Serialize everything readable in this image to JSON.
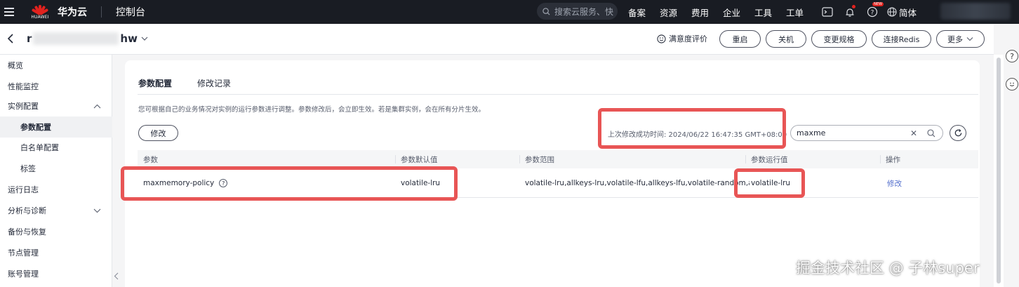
{
  "topbar": {
    "brand_word": "HUAWEI",
    "brand": "华为云",
    "console": "控制台",
    "search_placeholder": "搜索云服务、快",
    "nav": [
      "备案",
      "资源",
      "费用",
      "企业",
      "工具",
      "工单"
    ],
    "new_badge": "NEW",
    "lang": "简体",
    "accent": "#e1221e"
  },
  "header": {
    "instance_prefix": "r",
    "instance_suffix": "hw",
    "rating": "满意度评价",
    "buttons": [
      "重启",
      "关机",
      "变更规格",
      "连接Redis",
      "更多"
    ]
  },
  "sidebar": {
    "items": [
      {
        "label": "概览"
      },
      {
        "label": "性能监控"
      },
      {
        "label": "实例配置"
      },
      {
        "label": "参数配置"
      },
      {
        "label": "白名单配置"
      },
      {
        "label": "标签"
      },
      {
        "label": "运行日志"
      },
      {
        "label": "分析与诊断"
      },
      {
        "label": "备份与恢复"
      },
      {
        "label": "节点管理"
      },
      {
        "label": "账号管理"
      }
    ]
  },
  "main": {
    "tabs": [
      "参数配置",
      "修改记录"
    ],
    "description": "您可根据自己的业务情况对实例的运行参数进行调整。参数修改后，会立即生效。若是集群实例，会在所有分片生效。",
    "modify_button": "修改",
    "last_modified": "上次修改成功时间: 2024/06/22 16:47:35 GMT+08:00",
    "filter_value": "maxme",
    "columns": [
      "参数",
      "参数默认值",
      "参数范围",
      "参数运行值",
      "操作"
    ],
    "rows": [
      {
        "param": "maxmemory-policy",
        "default": "volatile-lru",
        "range": "volatile-lru,allkeys-lru,volatile-lfu,allkeys-lfu,volatile-random,allk...",
        "running": "volatile-lru",
        "action": "修改"
      }
    ]
  },
  "watermark": "掘金技术社区 @ 子林super",
  "highlight_color": "#e85555",
  "link_color": "#526ecc"
}
